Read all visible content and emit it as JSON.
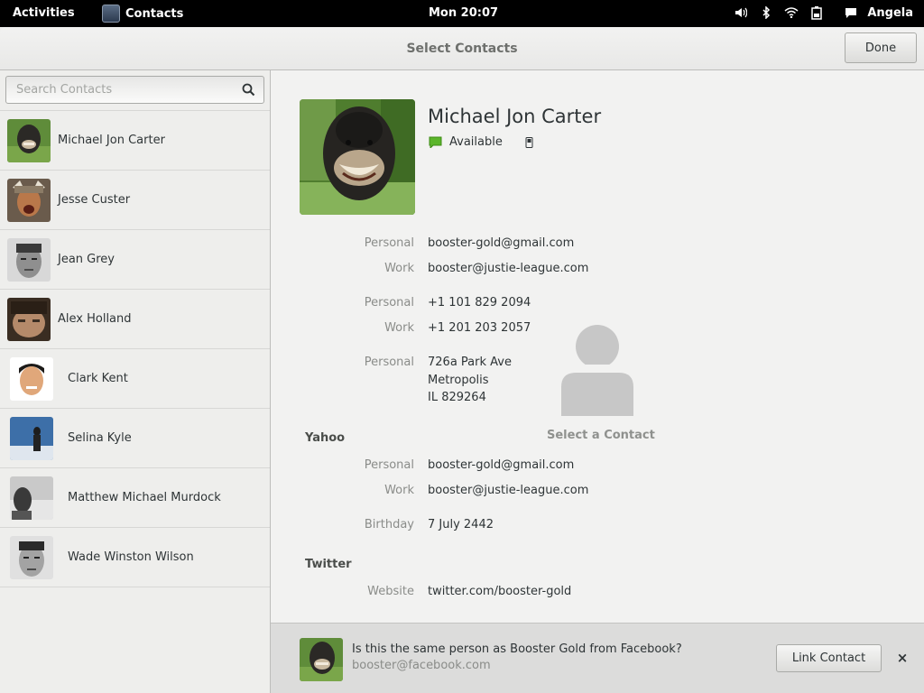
{
  "topbar": {
    "activities": "Activities",
    "app_name": "Contacts",
    "clock": "Mon 20:07",
    "user": "Angela",
    "tray_icons": [
      "volume-icon",
      "bluetooth-icon",
      "wifi-icon",
      "battery-icon",
      "chat-icon"
    ]
  },
  "header": {
    "title": "Select Contacts",
    "done_label": "Done"
  },
  "sidebar": {
    "search_placeholder": "Search Contacts",
    "contacts": [
      {
        "name": "Michael Jon Carter"
      },
      {
        "name": "Jesse Custer"
      },
      {
        "name": "Jean Grey"
      },
      {
        "name": "Alex Holland"
      },
      {
        "name": "Clark Kent"
      },
      {
        "name": "Selina Kyle"
      },
      {
        "name": "Matthew Michael Murdock"
      },
      {
        "name": "Wade Winston Wilson"
      }
    ]
  },
  "contact": {
    "name": "Michael Jon Carter",
    "presence": "Available",
    "emails": [
      {
        "label": "Personal",
        "value": "booster-gold@gmail.com"
      },
      {
        "label": "Work",
        "value": "booster@justie-league.com"
      }
    ],
    "phones": [
      {
        "label": "Personal",
        "value": "+1 101 829 2094"
      },
      {
        "label": "Work",
        "value": "+1 201 203 2057"
      }
    ],
    "address": {
      "label": "Personal",
      "line1": "726a Park Ave",
      "line2": "Metropolis",
      "line3": "IL 829264"
    },
    "yahoo": {
      "heading": "Yahoo",
      "emails": [
        {
          "label": "Personal",
          "value": "booster-gold@gmail.com"
        },
        {
          "label": "Work",
          "value": "booster@justie-league.com"
        }
      ],
      "birthday_label": "Birthday",
      "birthday": "7 July 2442"
    },
    "twitter": {
      "heading": "Twitter",
      "website_label": "Website",
      "website": "twitter.com/booster-gold"
    }
  },
  "placeholder": {
    "label": "Select a Contact"
  },
  "notification": {
    "question": "Is this the same person as Booster Gold from Facebook?",
    "email": "booster@facebook.com",
    "link_label": "Link Contact",
    "close_label": "×"
  },
  "colors": {
    "topbar_bg": "#000000",
    "window_bg": "#eeeeec",
    "presence_green": "#4e9a06"
  }
}
